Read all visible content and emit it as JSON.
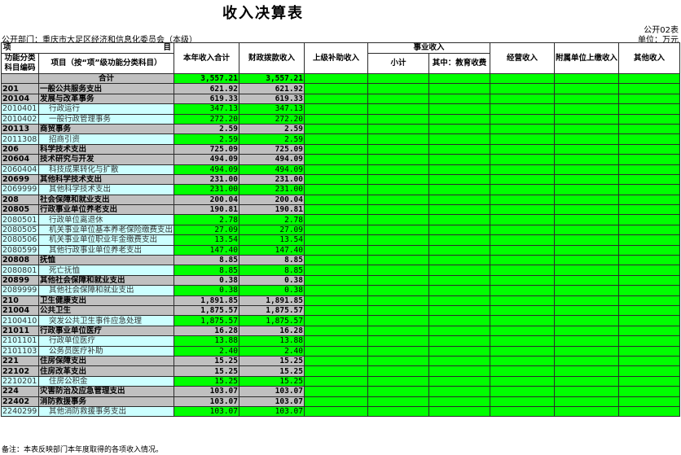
{
  "title": "收入决算表",
  "form_no": "公开02表",
  "department": "公开部门：重庆市大足区经济和信息化委员会（本级）",
  "unit": "单位：万元",
  "note": "备注：本表反映部门本年度取得的各项收入情况。",
  "colors": {
    "input_cell": "#00ff00",
    "locked_cell": "#c0c0c0",
    "detail_row": "#ccffff"
  },
  "header": {
    "item": "项",
    "item_right": "目",
    "code": "功能分类科目编码",
    "name": "项目（按“项”级功能分类科目）",
    "col_total": "本年收入合计",
    "col_fiscal": "财政拨款收入",
    "col_superior": "上级补助收入",
    "col_business_group": "事业收入",
    "col_business_sub": "小计",
    "col_business_edu": "其中：教育收费",
    "col_operating": "经营收入",
    "col_affiliated": "附属单位上缴收入",
    "col_other": "其他收入"
  },
  "rows": [
    {
      "code": "",
      "name": "合计",
      "total": "3,557.21",
      "fiscal": "3,557.21",
      "type": "total"
    },
    {
      "code": "201",
      "name": "一般公共服务支出",
      "total": "621.92",
      "fiscal": "621.92",
      "type": "head"
    },
    {
      "code": "20104",
      "name": "发展与改革事务",
      "total": "619.33",
      "fiscal": "619.33",
      "type": "head"
    },
    {
      "code": "2010401",
      "name": "行政运行",
      "total": "347.13",
      "fiscal": "347.13",
      "type": "detail"
    },
    {
      "code": "2010402",
      "name": "一般行政管理事务",
      "total": "272.20",
      "fiscal": "272.20",
      "type": "detail"
    },
    {
      "code": "20113",
      "name": "商贸事务",
      "total": "2.59",
      "fiscal": "2.59",
      "type": "head"
    },
    {
      "code": "2011308",
      "name": "招商引资",
      "total": "2.59",
      "fiscal": "2.59",
      "type": "detail"
    },
    {
      "code": "206",
      "name": "科学技术支出",
      "total": "725.09",
      "fiscal": "725.09",
      "type": "head"
    },
    {
      "code": "20604",
      "name": "技术研究与开发",
      "total": "494.09",
      "fiscal": "494.09",
      "type": "head"
    },
    {
      "code": "2060404",
      "name": "科技成果转化与扩散",
      "total": "494.09",
      "fiscal": "494.09",
      "type": "detail"
    },
    {
      "code": "20699",
      "name": "其他科学技术支出",
      "total": "231.00",
      "fiscal": "231.00",
      "type": "head"
    },
    {
      "code": "2069999",
      "name": "其他科学技术支出",
      "total": "231.00",
      "fiscal": "231.00",
      "type": "detail"
    },
    {
      "code": "208",
      "name": "社会保障和就业支出",
      "total": "200.04",
      "fiscal": "200.04",
      "type": "head"
    },
    {
      "code": "20805",
      "name": "行政事业单位养老支出",
      "total": "190.81",
      "fiscal": "190.81",
      "type": "head"
    },
    {
      "code": "2080501",
      "name": "行政单位离退休",
      "total": "2.78",
      "fiscal": "2.78",
      "type": "detail"
    },
    {
      "code": "2080505",
      "name": "机关事业单位基本养老保险缴费支出",
      "total": "27.09",
      "fiscal": "27.09",
      "type": "detail"
    },
    {
      "code": "2080506",
      "name": "机关事业单位职业年金缴费支出",
      "total": "13.54",
      "fiscal": "13.54",
      "type": "detail"
    },
    {
      "code": "2080599",
      "name": "其他行政事业单位养老支出",
      "total": "147.40",
      "fiscal": "147.40",
      "type": "detail"
    },
    {
      "code": "20808",
      "name": "抚恤",
      "total": "8.85",
      "fiscal": "8.85",
      "type": "head"
    },
    {
      "code": "2080801",
      "name": "死亡抚恤",
      "total": "8.85",
      "fiscal": "8.85",
      "type": "detail"
    },
    {
      "code": "20899",
      "name": "其他社会保障和就业支出",
      "total": "0.38",
      "fiscal": "0.38",
      "type": "head"
    },
    {
      "code": "2089999",
      "name": "其他社会保障和就业支出",
      "total": "0.38",
      "fiscal": "0.38",
      "type": "detail"
    },
    {
      "code": "210",
      "name": "卫生健康支出",
      "total": "1,891.85",
      "fiscal": "1,891.85",
      "type": "head"
    },
    {
      "code": "21004",
      "name": "公共卫生",
      "total": "1,875.57",
      "fiscal": "1,875.57",
      "type": "head"
    },
    {
      "code": "2100410",
      "name": "突发公共卫生事件应急处理",
      "total": "1,875.57",
      "fiscal": "1,875.57",
      "type": "detail"
    },
    {
      "code": "21011",
      "name": "行政事业单位医疗",
      "total": "16.28",
      "fiscal": "16.28",
      "type": "head"
    },
    {
      "code": "2101101",
      "name": "行政单位医疗",
      "total": "13.88",
      "fiscal": "13.88",
      "type": "detail"
    },
    {
      "code": "2101103",
      "name": "公务员医疗补助",
      "total": "2.40",
      "fiscal": "2.40",
      "type": "detail"
    },
    {
      "code": "221",
      "name": "住房保障支出",
      "total": "15.25",
      "fiscal": "15.25",
      "type": "head"
    },
    {
      "code": "22102",
      "name": "住房改革支出",
      "total": "15.25",
      "fiscal": "15.25",
      "type": "head"
    },
    {
      "code": "2210201",
      "name": "住房公积金",
      "total": "15.25",
      "fiscal": "15.25",
      "type": "detail"
    },
    {
      "code": "224",
      "name": "灾害防治及应急管理支出",
      "total": "103.07",
      "fiscal": "103.07",
      "type": "head"
    },
    {
      "code": "22402",
      "name": "消防救援事务",
      "total": "103.07",
      "fiscal": "103.07",
      "type": "head"
    },
    {
      "code": "2240299",
      "name": "其他消防救援事务支出",
      "total": "103.07",
      "fiscal": "103.07",
      "type": "detail"
    }
  ]
}
